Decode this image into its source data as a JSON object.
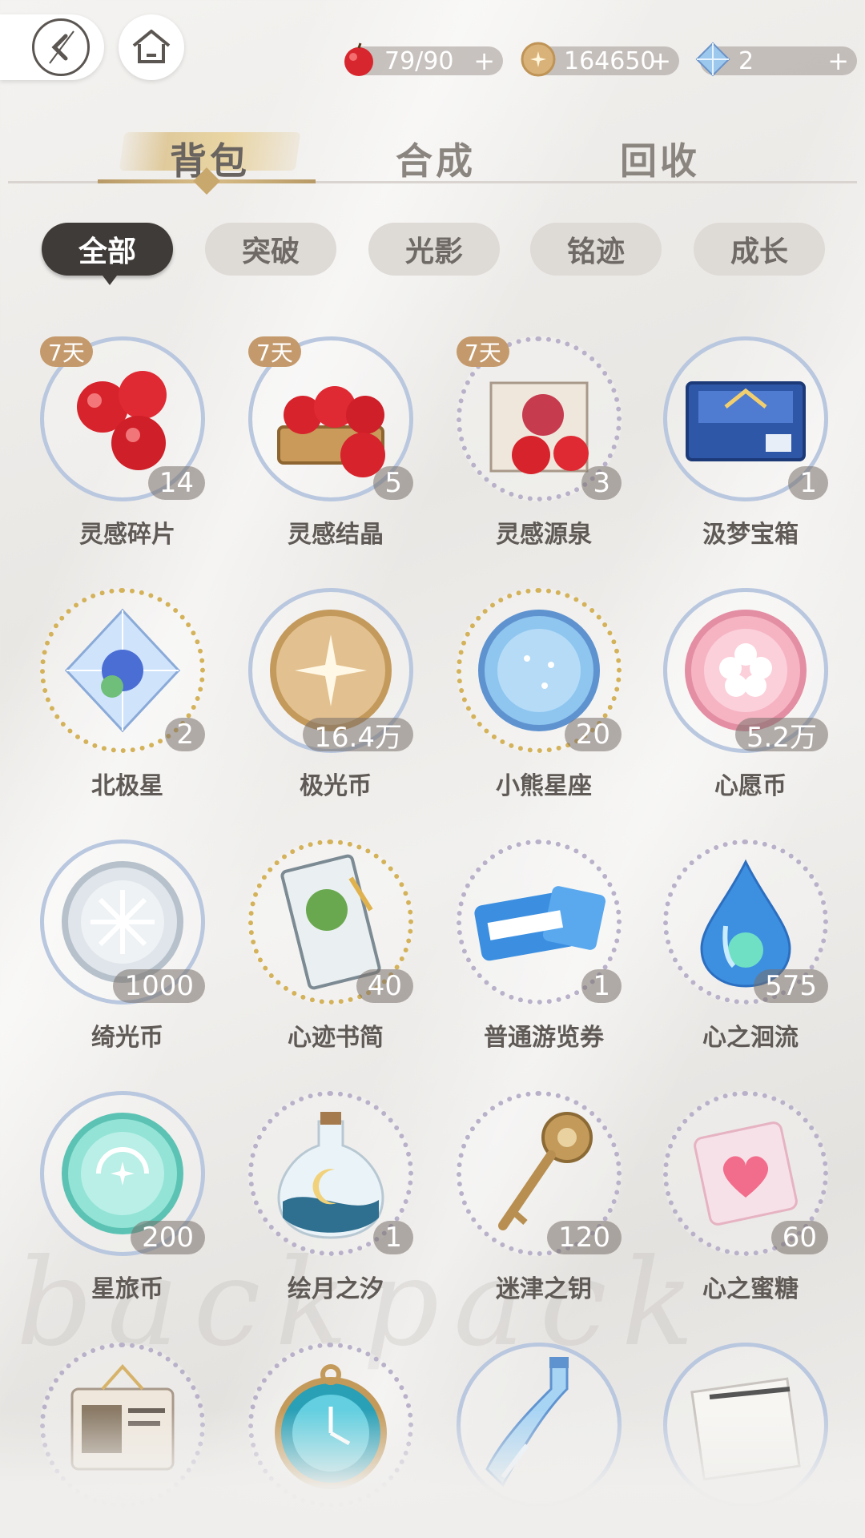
{
  "resources": [
    {
      "name": "apple",
      "value": "79/90",
      "plus": "+",
      "color": "#d8262e"
    },
    {
      "name": "coin",
      "value": "164650",
      "plus": "+",
      "color": "#d9b27a"
    },
    {
      "name": "diamond",
      "value": "2",
      "plus": "+",
      "color": "#8fc0e8"
    }
  ],
  "tabs": {
    "bag": "背包",
    "craft": "合成",
    "recycle": "回收"
  },
  "filters": {
    "all": "全部",
    "breakthrough": "突破",
    "light": "光影",
    "trace": "铭迹",
    "growth": "成长"
  },
  "items": [
    {
      "name": "灵感碎片",
      "count": "14",
      "day_badge": "7天",
      "art": "apples"
    },
    {
      "name": "灵感结晶",
      "count": "5",
      "day_badge": "7天",
      "art": "apple-basket"
    },
    {
      "name": "灵感源泉",
      "count": "3",
      "day_badge": "7天",
      "art": "apple-box"
    },
    {
      "name": "汲梦宝箱",
      "count": "1",
      "day_badge": "",
      "art": "blue-chest"
    },
    {
      "name": "北极星",
      "count": "2",
      "day_badge": "",
      "art": "crystal"
    },
    {
      "name": "极光币",
      "count": "16.4万",
      "day_badge": "",
      "art": "gold-coin"
    },
    {
      "name": "小熊星座",
      "count": "20",
      "day_badge": "",
      "art": "blue-coin"
    },
    {
      "name": "心愿币",
      "count": "5.2万",
      "day_badge": "",
      "art": "pink-coin"
    },
    {
      "name": "绮光币",
      "count": "1000",
      "day_badge": "",
      "art": "silver-coin"
    },
    {
      "name": "心迹书简",
      "count": "40",
      "day_badge": "",
      "art": "letter"
    },
    {
      "name": "普通游览券",
      "count": "1",
      "day_badge": "",
      "art": "ticket"
    },
    {
      "name": "心之洄流",
      "count": "575",
      "day_badge": "",
      "art": "drop"
    },
    {
      "name": "星旅币",
      "count": "200",
      "day_badge": "",
      "art": "teal-coin"
    },
    {
      "name": "绘月之汐",
      "count": "1",
      "day_badge": "",
      "art": "moon-bottle"
    },
    {
      "name": "迷津之钥",
      "count": "120",
      "day_badge": "",
      "art": "key"
    },
    {
      "name": "心之蜜糖",
      "count": "60",
      "day_badge": "",
      "art": "candy"
    },
    {
      "name": "",
      "count": "",
      "day_badge": "",
      "art": "id-card"
    },
    {
      "name": "",
      "count": "",
      "day_badge": "",
      "art": "pocket-watch"
    },
    {
      "name": "",
      "count": "",
      "day_badge": "",
      "art": "potion"
    },
    {
      "name": "",
      "count": "",
      "day_badge": "",
      "art": "paper"
    }
  ],
  "watermark": "backpack"
}
